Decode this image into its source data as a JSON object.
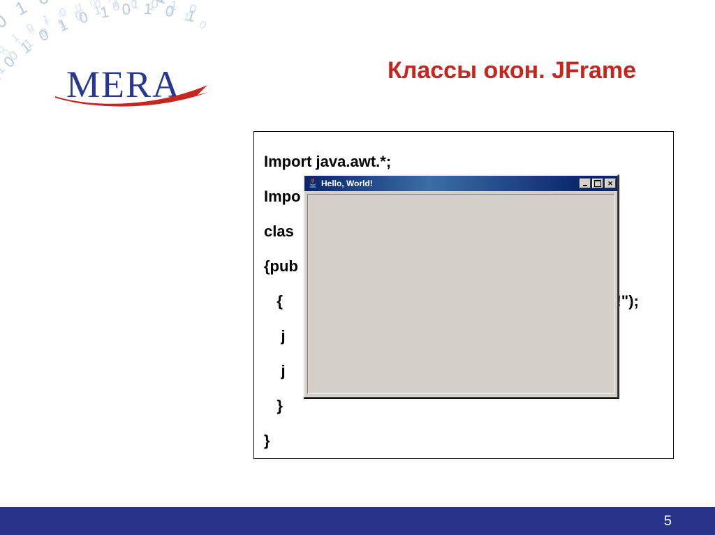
{
  "logo": {
    "text": "MERA"
  },
  "title": "Классы окон. JFrame",
  "code": {
    "l1": "Import java.awt.*;",
    "l2": "Impo",
    "l3": "clas",
    "l4": "{pub",
    "l5": "   {",
    "l5b": "orld!\");",
    "l6": "    j",
    "l7": "    j",
    "l8": "   }",
    "l9": "}"
  },
  "javawin": {
    "title": "Hello, World!",
    "close_glyph": "✕"
  },
  "footer": {
    "page": "5"
  }
}
